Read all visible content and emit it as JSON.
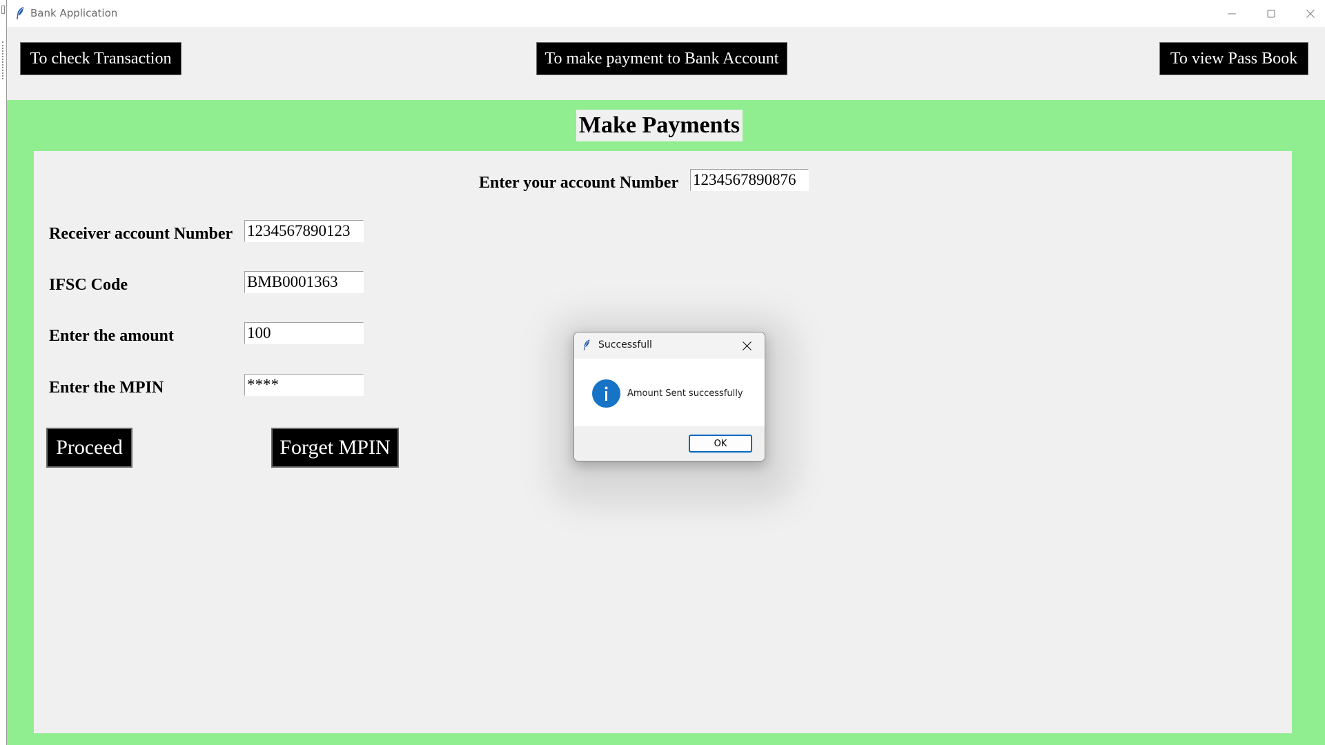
{
  "window": {
    "title": "Bank Application",
    "icon": "feather-icon"
  },
  "nav": {
    "check_transaction": "To check Transaction",
    "make_payment": "To make payment to Bank Account",
    "view_passbook": "To view Pass Book"
  },
  "page": {
    "heading": "Make Payments"
  },
  "form": {
    "account_label": "Enter your account Number",
    "account_value": "1234567890876",
    "receiver_label": "Receiver account Number",
    "receiver_value": "1234567890123",
    "ifsc_label": "IFSC Code",
    "ifsc_value": "BMB0001363",
    "amount_label": "Enter the amount",
    "amount_value": "100",
    "mpin_label": "Enter the MPIN",
    "mpin_value": "****",
    "proceed_label": "Proceed",
    "forget_label": "Forget MPIN"
  },
  "dialog": {
    "title": "Successfull",
    "message": "Amount Sent successfully",
    "ok_label": "OK",
    "icon": "info-icon"
  },
  "colors": {
    "background_green": "#90ee90",
    "panel": "#f0f0f0",
    "button_black": "#000000",
    "info_blue": "#1673c6",
    "focus_blue": "#0067c0"
  }
}
